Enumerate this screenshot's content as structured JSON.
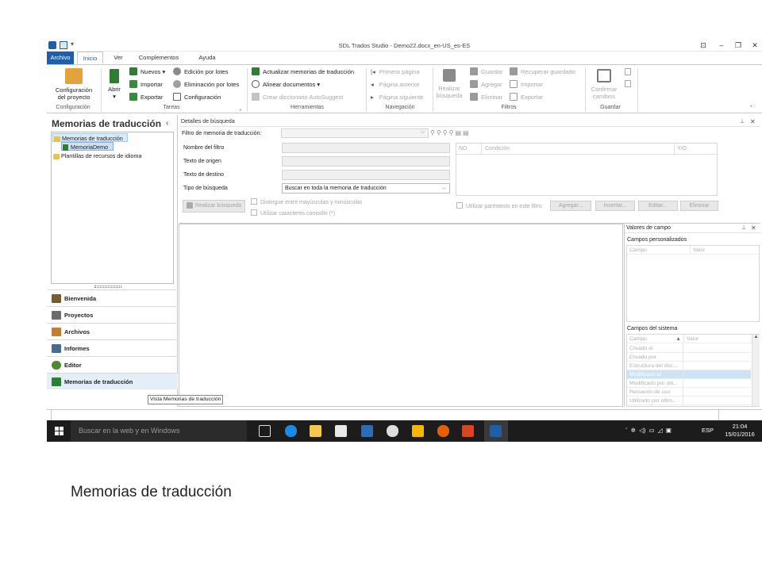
{
  "window": {
    "title": "SDL Trados Studio - Demo22.docx_en-US_es-ES"
  },
  "ribbon_tabs": [
    "Archivo",
    "Inicio",
    "Ver",
    "Complementos",
    "Ayuda"
  ],
  "groups": {
    "configuracion": {
      "label": "Configuración",
      "big_button": "Configuración del proyecto",
      "big_button_l1": "Configuración",
      "big_button_l2": "del proyecto"
    },
    "tareas": {
      "label": "Tareas",
      "abrir": "Abrir",
      "nuevos": "Nuevos",
      "importar": "Importar",
      "exportar": "Exportar",
      "edicion_lotes": "Edición por lotes",
      "eliminacion_lotes": "Eliminación por lotes",
      "configuracion": "Configuración"
    },
    "herramientas": {
      "label": "Herramientas",
      "actualizar": "Actualizar memorias de traducción",
      "alinear": "Alinear documentos",
      "crear_diccionario": "Crear diccionario AutoSuggest"
    },
    "navegacion": {
      "label": "Navegación",
      "primera": "Primera página",
      "anterior": "Página anterior",
      "siguiente": "Página siguiente"
    },
    "filtros": {
      "label": "Filtros",
      "realizar_l1": "Realizar",
      "realizar_l2": "búsqueda",
      "guardar": "Guardar",
      "agregar": "Agregar",
      "eliminar": "Eliminar",
      "recuperar": "Recuperar guardado",
      "importar": "Importar",
      "exportar": "Exportar"
    },
    "guardar": {
      "label": "Guardar",
      "confirmar_l1": "Confirmar",
      "confirmar_l2": "cambios"
    }
  },
  "nav_panel": {
    "title": "Memorias de traducción",
    "tree": {
      "root": "Memorias de traducción",
      "child": "MemoriaDemo",
      "templates": "Plantillas de recursos de idioma"
    },
    "buttons": [
      {
        "label": "Bienvenida",
        "icon": "home-icon",
        "color": "#7a5b2e"
      },
      {
        "label": "Proyectos",
        "icon": "folder-icon",
        "color": "#6b6b6b"
      },
      {
        "label": "Archivos",
        "icon": "files-icon",
        "color": "#c97c2a"
      },
      {
        "label": "Informes",
        "icon": "report-icon",
        "color": "#4a6b8a"
      },
      {
        "label": "Editor",
        "icon": "pencil-icon",
        "color": "#4e8a2e"
      },
      {
        "label": "Memorias de traducción",
        "icon": "tm-icon",
        "color": "#2e7d32"
      }
    ]
  },
  "search_details": {
    "header": "Detalles de búsqueda",
    "filter_label": "Filtro de memoria de traducción:",
    "nombre_filtro": "Nombre del filtro",
    "texto_origen": "Texto de origen",
    "texto_destino": "Texto de destino",
    "tipo_busqueda": "Tipo de búsqueda",
    "tipo_busqueda_value": "Buscar en toda la memoria de traducción",
    "realizar_busqueda": "Realizar búsqueda",
    "distingue": "Distingue entre mayúsculas y minúsculas",
    "comodin": "Utilizar caracteres comodín (*)",
    "parentesis": "Utilizar paréntesis en este filtro",
    "col_no": "NO",
    "col_condicion": "Condición",
    "col_yo": "Y/O",
    "agregar": "Agregar...",
    "insertar": "Insertar...",
    "editar": "Editar...",
    "eliminar": "Eliminar"
  },
  "values_panel": {
    "title": "Valores de campo",
    "custom_fields": "Campos personalizados",
    "col_campo": "Campo",
    "col_valor": "Valor",
    "system_fields": "Campos del sistema",
    "system_rows": [
      "Creado el",
      "Creado por",
      "Estructura del doc...",
      "Modificado el",
      "Modificado por últi...",
      "Recuento de uso",
      "Utilizado por últim..."
    ]
  },
  "tooltip": "Vista Memorias de traducción",
  "taskbar": {
    "search_placeholder": "Buscar en la web y en Windows",
    "lang": "ESP",
    "time": "21:04",
    "date": "15/01/2016"
  },
  "caption": "Memorias de traducción",
  "colors": {
    "accent": "#1e5fa8",
    "taskbar": "#1c1c1c"
  }
}
